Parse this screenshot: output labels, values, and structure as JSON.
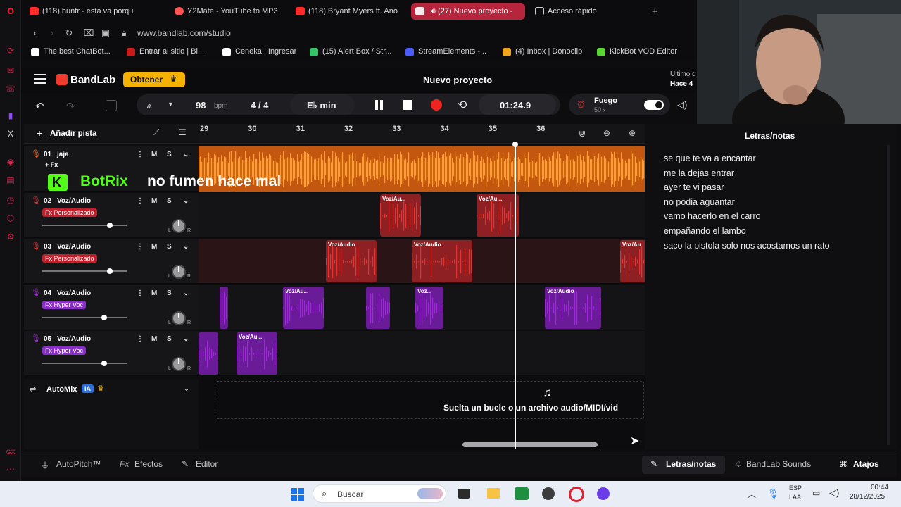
{
  "browser": {
    "tabs": [
      {
        "label": "(118) huntr - esta va porqu",
        "color": "#ff2a2a"
      },
      {
        "label": "Y2Mate - YouTube to MP3",
        "color": "#ff5252"
      },
      {
        "label": "(118) Bryant Myers ft. Ano",
        "color": "#ff2a2a"
      },
      {
        "label": "(27) Nuevo proyecto -",
        "color": "#ffffff"
      },
      {
        "label": "Acceso rápido",
        "color": "#cccccc"
      }
    ],
    "new_tab_glyph": "+",
    "url": "www.bandlab.com/studio",
    "bookmarks": [
      {
        "label": "The best ChatBot...",
        "color": "#ffffff"
      },
      {
        "label": "Entrar al sitio | Bl...",
        "color": "#cc1b1b"
      },
      {
        "label": "Ceneka | Ingresar",
        "color": "#ffffff"
      },
      {
        "label": "(15) Alert Box / Str...",
        "color": "#35c46a"
      },
      {
        "label": "StreamElements -...",
        "color": "#4b5cff"
      },
      {
        "label": "(4) Inbox | Donoclip",
        "color": "#f0a51f"
      },
      {
        "label": "KickBot VOD Editor",
        "color": "#5ad634"
      }
    ]
  },
  "bandlab": {
    "brand": "BandLab",
    "get_button": "Obtener",
    "project_title": "Nuevo proyecto",
    "last_saved_1": "Último g",
    "last_saved_2": "Hace 4",
    "tempo": "98",
    "tempo_unit": "bpm",
    "time_signature": "4 / 4",
    "key": "E♭ min",
    "time_display": "01:24.9",
    "fuego_label": "Fuego",
    "fuego_count": "50 ›",
    "add_track": "Añadir pista",
    "ruler": [
      "29",
      "30",
      "31",
      "32",
      "33",
      "34",
      "35",
      "36"
    ],
    "tracks": [
      {
        "num": "01",
        "name": "jaja",
        "fx": "+ Fx",
        "fx_color": "none",
        "color": "#ff6a13",
        "mute": "M",
        "solo": "S",
        "volume": 0.8
      },
      {
        "num": "02",
        "name": "Voz/Audio",
        "fx": "Fx Personalizado",
        "fx_color": "#c0202c",
        "color": "#e5332f",
        "mute": "M",
        "solo": "S",
        "volume": 0.8
      },
      {
        "num": "03",
        "name": "Voz/Audio",
        "fx": "Fx Personalizado",
        "fx_color": "#c0202c",
        "color": "#e5332f",
        "mute": "M",
        "solo": "S",
        "volume": 0.8
      },
      {
        "num": "04",
        "name": "Voz/Audio",
        "fx": "Fx Hyper Voc",
        "fx_color": "#8a2ec9",
        "color": "#a324e0",
        "mute": "M",
        "solo": "S",
        "volume": 0.73
      },
      {
        "num": "05",
        "name": "Voz/Audio",
        "fx": "Fx Hyper Voc",
        "fx_color": "#8a2ec9",
        "color": "#a324e0",
        "mute": "M",
        "solo": "S",
        "volume": 0.73
      }
    ],
    "regions": {
      "t2": [
        "Voz/Au...",
        "Voz/Au..."
      ],
      "t3": [
        "Voz/Audio",
        "Voz/Audio",
        "Voz/Au"
      ],
      "t4": [
        "Voz/Au...",
        "Voz...",
        "Voz/Audio"
      ],
      "t5": [
        "Voz/Au..."
      ]
    },
    "overlay_brand": "BotRix",
    "overlay_text": "no fumen hace mal",
    "automix": "AutoMix",
    "automix_badge": "IA",
    "drop_text": "Suelta un bucle o un archivo audio/MIDI/vid",
    "lyrics_title": "Letras/notas",
    "lyrics": [
      "se que te va a encantar",
      "me la dejas  entrar",
      "ayer te vi pasar",
      "no podia aguantar",
      "vamo hacerlo en el carro",
      "empañando el lambo",
      "saco la pistola solo nos acostamos un rato"
    ],
    "bottom_left": [
      "AutoPitch™",
      "Efectos",
      "Editor"
    ],
    "bottom_right": [
      "Letras/notas",
      "BandLab Sounds",
      "Atajos"
    ]
  },
  "taskbar": {
    "search_placeholder": "Buscar",
    "lang_1": "ESP",
    "lang_2": "LAA",
    "time": "00:44",
    "date": "28/12/2025"
  }
}
